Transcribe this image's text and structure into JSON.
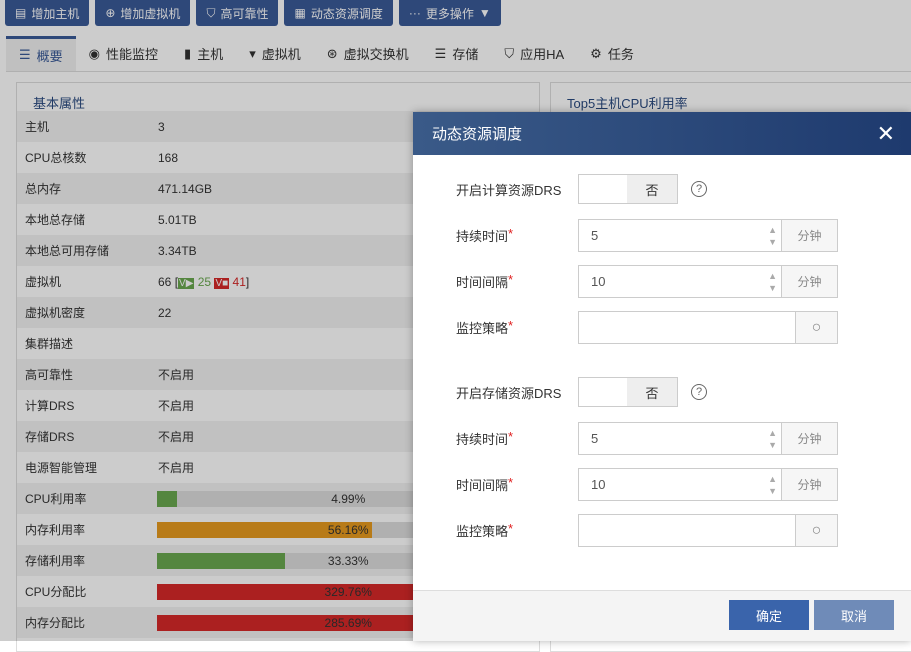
{
  "toolbar": [
    {
      "label": "增加主机",
      "icon": "host-add-icon"
    },
    {
      "label": "增加虚拟机",
      "icon": "plus-circle-icon"
    },
    {
      "label": "高可靠性",
      "icon": "shield-icon"
    },
    {
      "label": "动态资源调度",
      "icon": "drs-icon"
    },
    {
      "label": "更多操作",
      "icon": "more-icon"
    }
  ],
  "tabs": [
    {
      "label": "概要",
      "icon": "list-icon"
    },
    {
      "label": "性能监控",
      "icon": "monitor-icon"
    },
    {
      "label": "主机",
      "icon": "server-icon"
    },
    {
      "label": "虚拟机",
      "icon": "vm-icon"
    },
    {
      "label": "虚拟交换机",
      "icon": "switch-icon"
    },
    {
      "label": "存储",
      "icon": "database-icon"
    },
    {
      "label": "应用HA",
      "icon": "shield-icon"
    },
    {
      "label": "任务",
      "icon": "gear-icon"
    }
  ],
  "basic": {
    "title": "基本属性",
    "rows": [
      {
        "label": "主机",
        "value": "3"
      },
      {
        "label": "CPU总核数",
        "value": "168"
      },
      {
        "label": "总内存",
        "value": "471.14GB"
      },
      {
        "label": "本地总存储",
        "value": "5.01TB"
      },
      {
        "label": "本地总可用存储",
        "value": "3.34TB"
      },
      {
        "label": "虚拟机",
        "total": "66",
        "running": "25",
        "stopped": "41"
      },
      {
        "label": "虚拟机密度",
        "value": "22"
      },
      {
        "label": "集群描述",
        "value": ""
      },
      {
        "label": "高可靠性",
        "value": "不启用"
      },
      {
        "label": "计算DRS",
        "value": "不启用"
      },
      {
        "label": "存储DRS",
        "value": "不启用"
      },
      {
        "label": "电源智能管理",
        "value": "不启用"
      }
    ],
    "bars": [
      {
        "label": "CPU利用率",
        "text": "4.99%",
        "percent": 4.99,
        "color": "#6aa84f"
      },
      {
        "label": "内存利用率",
        "text": "56.16%",
        "percent": 56.16,
        "color": "#e69a1e"
      },
      {
        "label": "存储利用率",
        "text": "33.33%",
        "percent": 33.33,
        "color": "#6aa84f"
      },
      {
        "label": "CPU分配比",
        "text": "329.76%",
        "percent": 100,
        "color": "#d62828"
      },
      {
        "label": "内存分配比",
        "text": "285.69%",
        "percent": 100,
        "color": "#d62828"
      }
    ]
  },
  "top5": {
    "title": "Top5主机CPU利用率"
  },
  "modal": {
    "title": "动态资源调度",
    "compute": {
      "label": "开启计算资源DRS",
      "toggle": "否",
      "duration_label": "持续时间",
      "duration": "5",
      "interval_label": "时间间隔",
      "interval": "10",
      "unit": "分钟",
      "policy_label": "监控策略",
      "policy": ""
    },
    "storage": {
      "label": "开启存储资源DRS",
      "toggle": "否",
      "duration_label": "持续时间",
      "duration": "5",
      "interval_label": "时间间隔",
      "interval": "10",
      "unit": "分钟",
      "policy_label": "监控策略",
      "policy": ""
    },
    "ok": "确定",
    "cancel": "取消"
  }
}
